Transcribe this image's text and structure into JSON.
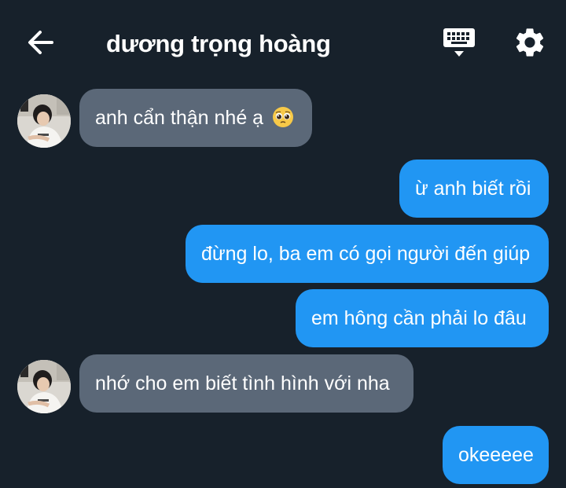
{
  "header": {
    "title": "dương trọng hoàng",
    "back_icon": "arrow-left-icon",
    "keyboard_icon": "keyboard-icon",
    "settings_icon": "gear-icon"
  },
  "messages": [
    {
      "side": "in",
      "text": "anh cẩn thận nhé ạ",
      "emoji": "pleading-face-emoji"
    },
    {
      "side": "out",
      "text": "ừ anh biết rồi"
    },
    {
      "side": "out",
      "text": "đừng lo, ba em có gọi người đến giúp"
    },
    {
      "side": "out",
      "text": "em hông cần phải lo đâu"
    },
    {
      "side": "in",
      "text": "nhớ cho em biết tình hình với nha"
    },
    {
      "side": "out",
      "text": "okeeeee"
    }
  ],
  "colors": {
    "background": "#17212b",
    "incoming_bubble": "#5b6878",
    "outgoing_bubble": "#2196f3",
    "text": "#ffffff"
  }
}
